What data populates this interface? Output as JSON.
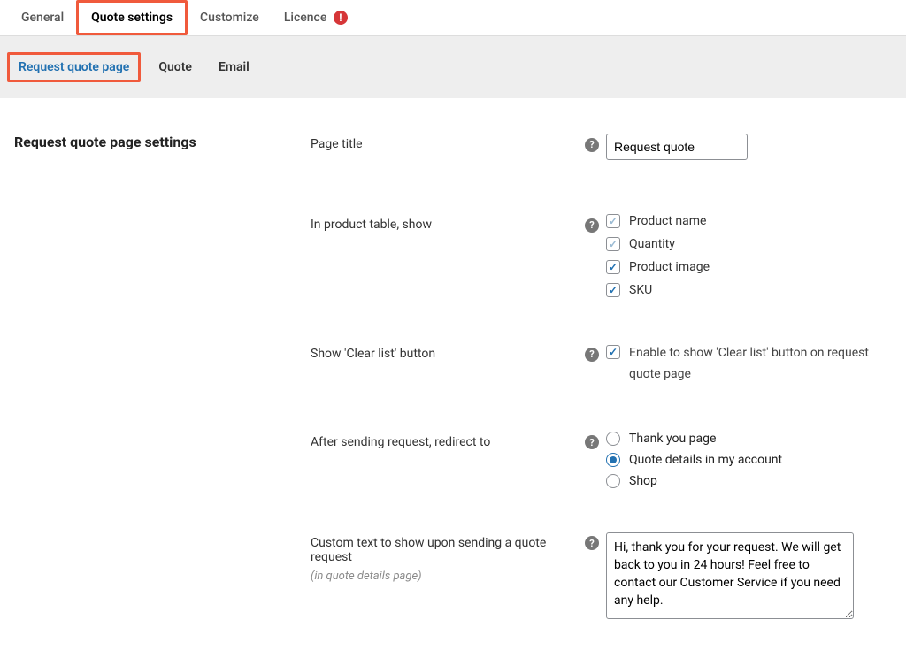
{
  "tabs": {
    "general": "General",
    "quote_settings": "Quote settings",
    "customize": "Customize",
    "licence": "Licence"
  },
  "subtabs": {
    "request_quote_page": "Request quote page",
    "quote": "Quote",
    "email": "Email"
  },
  "section_heading": "Request quote page settings",
  "fields": {
    "page_title": {
      "label": "Page title",
      "value": "Request quote"
    },
    "product_table": {
      "label": "In product table, show",
      "opts": {
        "product_name": "Product name",
        "quantity": "Quantity",
        "product_image": "Product image",
        "sku": "SKU"
      }
    },
    "clear_list": {
      "label": "Show 'Clear list' button",
      "desc": "Enable to show 'Clear list' button on request quote page"
    },
    "redirect": {
      "label": "After sending request, redirect to",
      "opts": {
        "thank_you": "Thank you page",
        "quote_details": "Quote details in my account",
        "shop": "Shop"
      }
    },
    "custom_text": {
      "label": "Custom text to show upon sending a quote request",
      "sub": "(in quote details page)",
      "value": "Hi, thank you for your request. We will get back to you in 24 hours! Feel free to contact our Customer Service if you need any help."
    }
  }
}
